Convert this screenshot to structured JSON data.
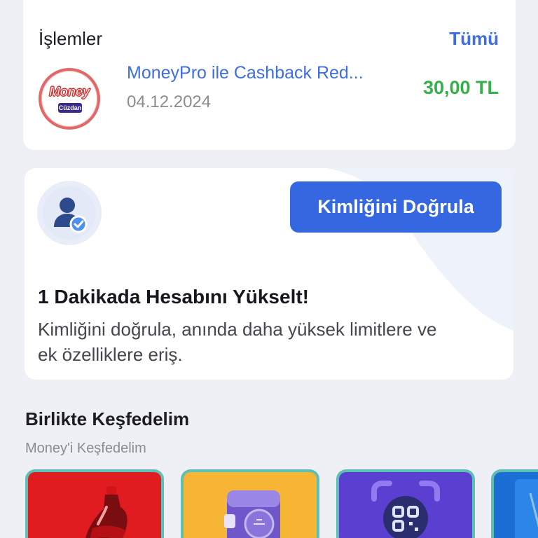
{
  "transactions": {
    "title": "İşlemler",
    "see_all": "Tümü",
    "items": [
      {
        "logo_text": "Money",
        "logo_subtext": "Cüzdan",
        "name": "MoneyPro ile Cashback Red...",
        "date": "04.12.2024",
        "amount": "30,00 TL"
      }
    ]
  },
  "verify": {
    "button_label": "Kimliğini Doğrula",
    "title": "1 Dakikada Hesabını Yükselt!",
    "description": "Kimliğini doğrula, anında daha yüksek limitlere ve ek özelliklere eriş."
  },
  "explore": {
    "title": "Birlikte Keşfedelim",
    "subtitle": "Money'i Keşfedelim",
    "tiles": [
      {
        "icon": "cola-bottle-icon",
        "color": "#e01c20"
      },
      {
        "icon": "wallet-icon",
        "color": "#f7b536"
      },
      {
        "icon": "qr-scan-icon",
        "color": "#5a3fd1"
      },
      {
        "icon": "card-icon",
        "color": "#1b6fd4"
      }
    ]
  },
  "colors": {
    "accent": "#3567e0",
    "link": "#3d6fe0",
    "positive": "#35b04a",
    "background": "#eef0f6"
  }
}
